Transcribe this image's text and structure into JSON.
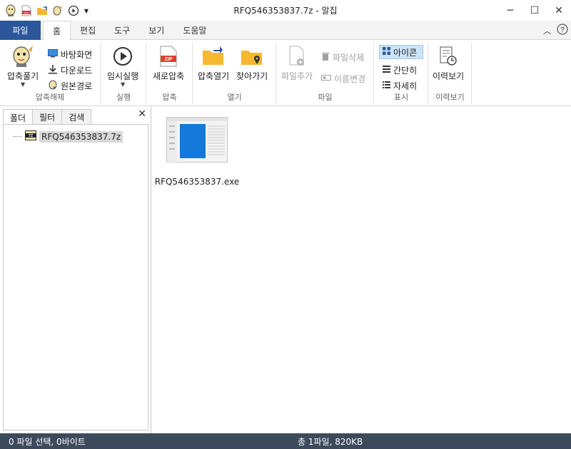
{
  "window": {
    "title": "RFQ546353837.7z - 알집"
  },
  "quick_access": {
    "icons": [
      "alzip-icon",
      "zip-icon",
      "folder-open-icon",
      "extract-icon",
      "play-icon",
      "dropdown-arrow-icon"
    ]
  },
  "tabs": {
    "file_label": "파일",
    "items": [
      "홈",
      "편집",
      "도구",
      "보기",
      "도움말"
    ],
    "active": "홈"
  },
  "ribbon": {
    "extract_group": {
      "label": "압축해제",
      "big_button": "압축풀기",
      "items": [
        "바탕화면",
        "다운로드",
        "원본경로"
      ]
    },
    "run_group": {
      "label": "실행",
      "big_button": "임시실행"
    },
    "compress_group": {
      "label": "압축",
      "big_button": "새로압축"
    },
    "open_group": {
      "label": "열기",
      "open_button": "압축열기",
      "find_button": "찾아가기"
    },
    "file_group": {
      "label": "파일",
      "add_button": "파일추가",
      "delete_button": "파일삭제",
      "rename_button": "이름변경"
    },
    "view_group": {
      "label": "표시",
      "items": [
        "아이콘",
        "간단히",
        "자세히"
      ],
      "selected": "아이콘"
    },
    "history_group": {
      "label": "이력보기",
      "big_button": "이력보기"
    }
  },
  "left_pane": {
    "tabs": [
      "폴더",
      "필터",
      "검색"
    ],
    "active_tab": "폴더",
    "tree_item": "RFQ546353837.7z"
  },
  "files": [
    {
      "name": "RFQ546353837.exe"
    }
  ],
  "status": {
    "selection": "0 파일 선택, 0바이트",
    "total": "총 1파일, 820KB"
  },
  "colors": {
    "file_tab": "#2b579a",
    "status_bar": "#3c4a5c",
    "selected_view": "#cce4f7"
  }
}
